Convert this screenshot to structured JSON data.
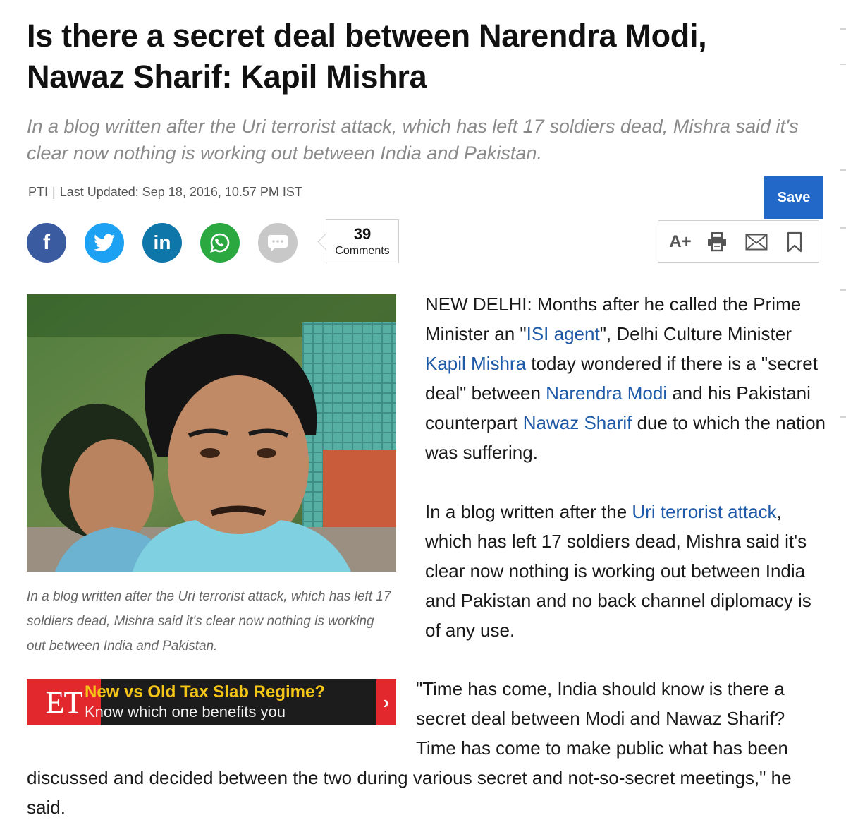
{
  "article": {
    "headline": "Is there a secret deal between Narendra Modi, Nawaz Sharif: Kapil Mishra",
    "synopsis": "In a blog written after the Uri terrorist attack, which has left 17 soldiers dead, Mishra said it's clear now nothing is working out between India and Pakistan.",
    "byline": {
      "source": "PTI",
      "separator": "|",
      "updated": "Last Updated: Sep 18, 2016, 10.57 PM IST"
    },
    "photo_caption": "In a blog written after the Uri terrorist attack, which has left 17 soldiers dead, Mishra said it's clear now nothing is working out between India and Pakistan.",
    "para1": {
      "t1": "NEW DELHI: Months after he called the Prime Minister an \"",
      "link1": "ISI agent",
      "t2": "\", Delhi Culture Minister ",
      "link2": "Kapil Mishra",
      "t3": " today wondered if there is a \"secret deal\" between ",
      "link3": "Narendra Modi",
      "t4": " and his Pakistani counterpart ",
      "link4": "Nawaz Sharif",
      "t5": " due to which the nation was suffering."
    },
    "para2": {
      "t1": "In a blog written after the ",
      "link1": "Uri terrorist attack",
      "t2": ", which has left 17 soldiers dead, Mishra said it's clear now nothing is working out between India and Pakistan and no back channel diplomacy is of any use."
    },
    "para3": "\"Time has come, India should know is there a secret deal between Modi and Nawaz Sharif? Time has come to make public what has been discussed and decided between the two during various secret and not-so-secret meetings,\" he said."
  },
  "share": {
    "facebook_glyph": "f",
    "linkedin_glyph": "in",
    "comments_count": "39",
    "comments_label": "Comments"
  },
  "tools": {
    "save_label": "Save",
    "font_size_label": "A+"
  },
  "promo": {
    "logo": "ET",
    "title": "New vs Old Tax Slab Regime?",
    "subtitle": "Know which one benefits you",
    "arrow": "›"
  },
  "colors": {
    "link": "#1e5aa8",
    "save_button": "#2268c9",
    "facebook": "#3b5ba0",
    "twitter": "#1da1f2",
    "linkedin": "#0e76a8",
    "whatsapp": "#2ba940",
    "promo_red": "#e3282d",
    "promo_yellow": "#f5c518"
  }
}
